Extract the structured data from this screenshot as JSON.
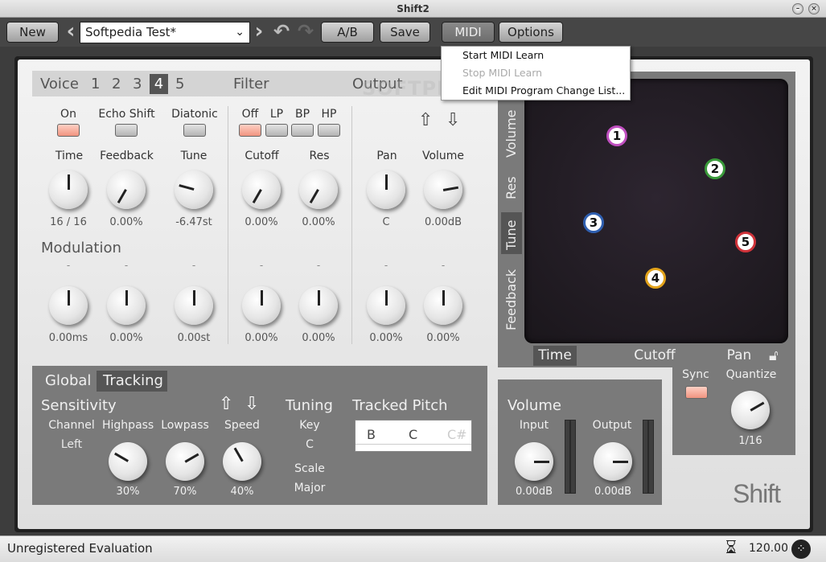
{
  "window": {
    "title": "Shift2"
  },
  "toolbar": {
    "new": "New",
    "preset": "Softpedia Test*",
    "ab": "A/B",
    "save": "Save",
    "midi": "MIDI",
    "options": "Options"
  },
  "menu": {
    "items": [
      {
        "label": "Start MIDI Learn",
        "enabled": true
      },
      {
        "label": "Stop MIDI Learn",
        "enabled": false
      },
      {
        "label": "Edit MIDI Program Change List...",
        "enabled": true
      }
    ]
  },
  "voice": {
    "label": "Voice",
    "numbers": [
      "1",
      "2",
      "3",
      "4",
      "5"
    ],
    "selected": "4"
  },
  "sections": {
    "filter": "Filter",
    "output": "Output",
    "modulation": "Modulation"
  },
  "switches": {
    "on": "On",
    "echo": "Echo Shift",
    "diatonic": "Diatonic",
    "off": "Off",
    "lp": "LP",
    "bp": "BP",
    "hp": "HP"
  },
  "params": {
    "time": {
      "label": "Time",
      "value": "16 / 16",
      "mod": "0.00ms"
    },
    "feedback": {
      "label": "Feedback",
      "value": "0.00%",
      "mod": "0.00%"
    },
    "tune": {
      "label": "Tune",
      "value": "-6.47st",
      "mod": "0.00st"
    },
    "cutoff": {
      "label": "Cutoff",
      "value": "0.00%",
      "mod": "0.00%"
    },
    "res": {
      "label": "Res",
      "value": "0.00%",
      "mod": "0.00%"
    },
    "pan": {
      "label": "Pan",
      "value": "C",
      "mod": "0.00%"
    },
    "volume": {
      "label": "Volume",
      "value": "0.00dB",
      "mod": "0.00%"
    }
  },
  "dash": "-",
  "xy": {
    "ytabs": [
      "Volume",
      "Res",
      "Tune",
      "Feedback"
    ],
    "ytab_selected": "Tune",
    "xtabs": [
      "Time",
      "Cutoff",
      "Pan"
    ],
    "xtab_selected": "Time",
    "nodes": [
      {
        "n": "1",
        "color": "#c04fc0"
      },
      {
        "n": "2",
        "color": "#3a9a3a"
      },
      {
        "n": "3",
        "color": "#2f5fb0"
      },
      {
        "n": "4",
        "color": "#e2a21a"
      },
      {
        "n": "5",
        "color": "#d0333a"
      }
    ]
  },
  "global": {
    "tab1": "Global",
    "tab2": "Tracking",
    "sensitivity": "Sensitivity",
    "channel": "Channel",
    "channel_val": "Left",
    "highpass": "Highpass",
    "highpass_val": "30%",
    "lowpass": "Lowpass",
    "lowpass_val": "70%",
    "speed": "Speed",
    "speed_val": "40%",
    "tuning": "Tuning",
    "key": "Key",
    "key_val": "C",
    "scale": "Scale",
    "scale_val": "Major",
    "tracked": "Tracked Pitch",
    "notes": [
      "B",
      "C",
      "C#"
    ]
  },
  "volpanel": {
    "title": "Volume",
    "input": "Input",
    "input_val": "0.00dB",
    "output": "Output",
    "output_val": "0.00dB"
  },
  "quant": {
    "sync": "Sync",
    "quantize": "Quantize",
    "value": "1/16"
  },
  "brand": "Shift",
  "watermark": "SOFTPEDIA",
  "status": {
    "text": "Unregistered Evaluation",
    "tempo": "120.00"
  }
}
